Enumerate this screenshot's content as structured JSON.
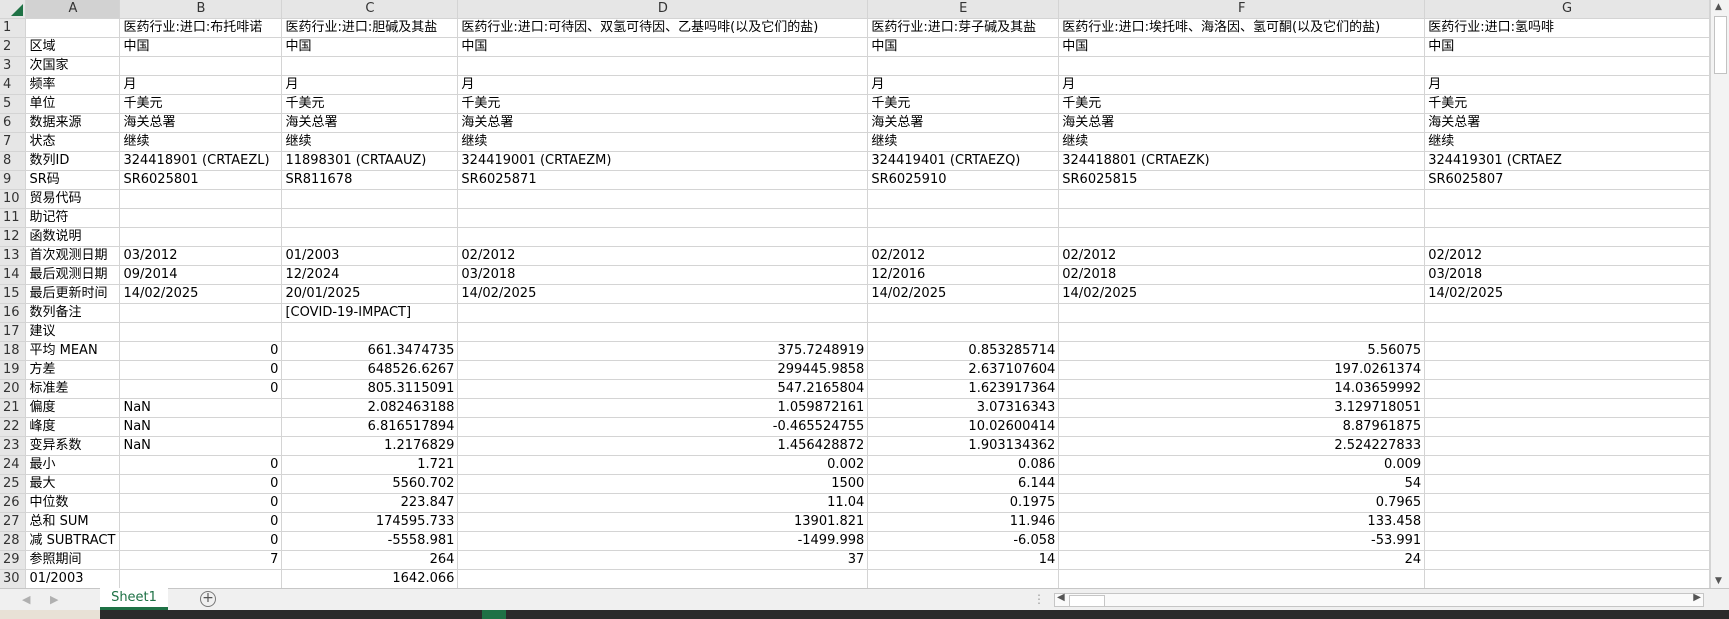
{
  "columns": [
    "A",
    "B",
    "C",
    "D",
    "E",
    "F",
    "G"
  ],
  "rows": [
    [
      "",
      "医药行业:进口:布托啡诺",
      "医药行业:进口:胆碱及其盐",
      "医药行业:进口:可待因、双氢可待因、乙基吗啡(以及它们的盐)",
      "医药行业:进口:芽子碱及其盐",
      "医药行业:进口:埃托啡、海洛因、氢可酮(以及它们的盐)",
      "医药行业:进口:氢吗啡"
    ],
    [
      "区域",
      "中国",
      "中国",
      "中国",
      "中国",
      "中国",
      "中国"
    ],
    [
      "次国家",
      "",
      "",
      "",
      "",
      "",
      ""
    ],
    [
      "频率",
      "月",
      "月",
      "月",
      "月",
      "月",
      "月"
    ],
    [
      "单位",
      "千美元",
      "千美元",
      "千美元",
      "千美元",
      "千美元",
      "千美元"
    ],
    [
      "数据来源",
      "海关总署",
      "海关总署",
      "海关总署",
      "海关总署",
      "海关总署",
      "海关总署"
    ],
    [
      "状态",
      "继续",
      "继续",
      "继续",
      "继续",
      "继续",
      "继续"
    ],
    [
      "数列ID",
      "324418901 (CRTAEZL)",
      "11898301 (CRTAAUZ)",
      "324419001 (CRTAEZM)",
      "324419401 (CRTAEZQ)",
      "324418801 (CRTAEZK)",
      "324419301 (CRTAEZ"
    ],
    [
      "SR码",
      "SR6025801",
      "SR811678",
      "SR6025871",
      "SR6025910",
      "SR6025815",
      "SR6025807"
    ],
    [
      "贸易代码",
      "",
      "",
      "",
      "",
      "",
      ""
    ],
    [
      "助记符",
      "",
      "",
      "",
      "",
      "",
      ""
    ],
    [
      "函数说明",
      "",
      "",
      "",
      "",
      "",
      ""
    ],
    [
      "首次观测日期",
      "03/2012",
      "01/2003",
      "02/2012",
      "02/2012",
      "02/2012",
      "02/2012"
    ],
    [
      "最后观测日期",
      "09/2014",
      "12/2024",
      "03/2018",
      "12/2016",
      "02/2018",
      "03/2018"
    ],
    [
      "最后更新时间",
      "14/02/2025",
      "20/01/2025",
      "14/02/2025",
      "14/02/2025",
      "14/02/2025",
      "14/02/2025"
    ],
    [
      "数列备注",
      "",
      "[COVID-19-IMPACT]",
      "",
      "",
      "",
      ""
    ],
    [
      "建议",
      "",
      "",
      "",
      "",
      "",
      ""
    ],
    [
      "平均 MEAN",
      "0",
      "661.3474735",
      "375.7248919",
      "0.853285714",
      "5.56075",
      ""
    ],
    [
      "方差",
      "0",
      "648526.6267",
      "299445.9858",
      "2.637107604",
      "197.0261374",
      ""
    ],
    [
      "标准差",
      "0",
      "805.3115091",
      "547.2165804",
      "1.623917364",
      "14.03659992",
      ""
    ],
    [
      "偏度",
      "NaN",
      "2.082463188",
      "1.059872161",
      "3.07316343",
      "3.129718051",
      ""
    ],
    [
      "峰度",
      "NaN",
      "6.816517894",
      "-0.465524755",
      "10.02600414",
      "8.87961875",
      ""
    ],
    [
      "变异系数",
      "NaN",
      "1.2176829",
      "1.456428872",
      "1.903134362",
      "2.524227833",
      ""
    ],
    [
      "最小",
      "0",
      "1.721",
      "0.002",
      "0.086",
      "0.009",
      ""
    ],
    [
      "最大",
      "0",
      "5560.702",
      "1500",
      "6.144",
      "54",
      ""
    ],
    [
      "中位数",
      "0",
      "223.847",
      "11.04",
      "0.1975",
      "0.7965",
      ""
    ],
    [
      "总和 SUM",
      "0",
      "174595.733",
      "13901.821",
      "11.946",
      "133.458",
      ""
    ],
    [
      "减 SUBTRACT",
      "0",
      "-5558.981",
      "-1499.998",
      "-6.058",
      "-53.991",
      ""
    ],
    [
      "参照期间",
      "7",
      "264",
      "37",
      "14",
      "24",
      ""
    ],
    [
      "01/2003",
      "",
      "1642.066",
      "",
      "",
      "",
      ""
    ]
  ],
  "sheet_tabs": [
    "Sheet1"
  ],
  "active_sheet": "Sheet1",
  "icons": {
    "select_all": "select-all-triangle-icon",
    "add_sheet": "plus-circle-icon"
  },
  "colors": {
    "accent": "#1e7145",
    "header_bg": "#e6e6e6",
    "gridline": "#d4d4d4"
  }
}
